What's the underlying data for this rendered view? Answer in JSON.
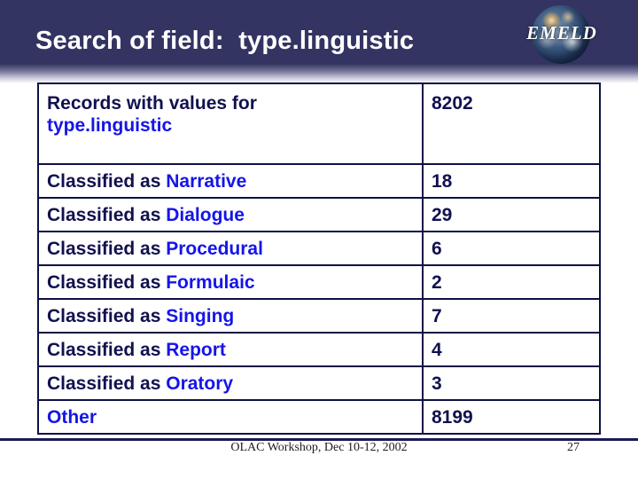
{
  "slide": {
    "title": "Search of field:  type.linguistic",
    "header_bg": "#343463",
    "accent_blue": "#1515e8",
    "dark_navy": "#11114f"
  },
  "logo": {
    "wordmark": "EMELD",
    "globe_icon": "globe-icon"
  },
  "table": {
    "rows": [
      {
        "label_dark": "Records with values for",
        "label_blue": "type.linguistic",
        "value": "8202"
      },
      {
        "label_dark": "Classified as ",
        "label_blue": "Narrative",
        "value": "18"
      },
      {
        "label_dark": "Classified as ",
        "label_blue": "Dialogue",
        "value": "29"
      },
      {
        "label_dark": "Classified as ",
        "label_blue": "Procedural",
        "value": "6"
      },
      {
        "label_dark": "Classified as ",
        "label_blue": "Formulaic",
        "value": "2"
      },
      {
        "label_dark": "Classified as ",
        "label_blue": "Singing",
        "value": "7"
      },
      {
        "label_dark": "Classified as ",
        "label_blue": "Report",
        "value": "4"
      },
      {
        "label_dark": "Classified as ",
        "label_blue": "Oratory",
        "value": "3"
      },
      {
        "label_dark": "",
        "label_blue": "Other",
        "value": "8199"
      }
    ]
  },
  "footer": {
    "note": "OLAC Workshop, Dec 10-12, 2002",
    "page_number": "27"
  }
}
